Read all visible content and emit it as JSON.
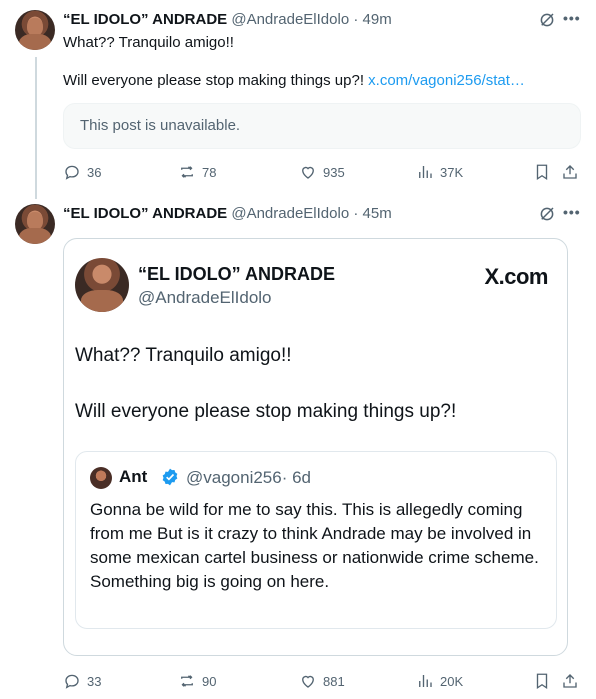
{
  "tweets": [
    {
      "author_name": "“EL IDOLO” ANDRADE",
      "author_handle": "@AndradeElIdolo",
      "time": "· 49m",
      "text_line1": "What?? Tranquilo amigo!!",
      "text_line2": "Will everyone please stop making things up?!",
      "link_text": "x.com/vagoni256/stat…",
      "unavailable_text": "This post is unavailable.",
      "actions": {
        "replies": "36",
        "reposts": "78",
        "likes": "935",
        "views": "37K"
      }
    },
    {
      "author_name": "“EL IDOLO” ANDRADE",
      "author_handle": "@AndradeElIdolo",
      "time": "· 45m",
      "card": {
        "name": "“EL IDOLO” ANDRADE",
        "handle": "@AndradeElIdolo",
        "brand": "X.com",
        "text_line1": "What?? Tranquilo amigo!!",
        "text_line2": "Will everyone please stop making things up?!",
        "quote": {
          "name": "Ant",
          "handle": "@vagoni256",
          "time": "· 6d",
          "text": "Gonna be wild for me to say this. This is allegedly coming from me But is it crazy to think Andrade may be involved in some mexican cartel business or nationwide crime scheme. Something big is going on here."
        }
      },
      "actions": {
        "replies": "33",
        "reposts": "90",
        "likes": "881",
        "views": "20K"
      }
    }
  ],
  "icons": [
    "grok-icon",
    "more-icon",
    "reply-icon",
    "repost-icon",
    "like-icon",
    "views-icon",
    "bookmark-icon",
    "share-icon",
    "verified-icon"
  ],
  "colors": {
    "link": "#1d9bf0",
    "muted": "#536471",
    "verified": "#1d9bf0"
  }
}
